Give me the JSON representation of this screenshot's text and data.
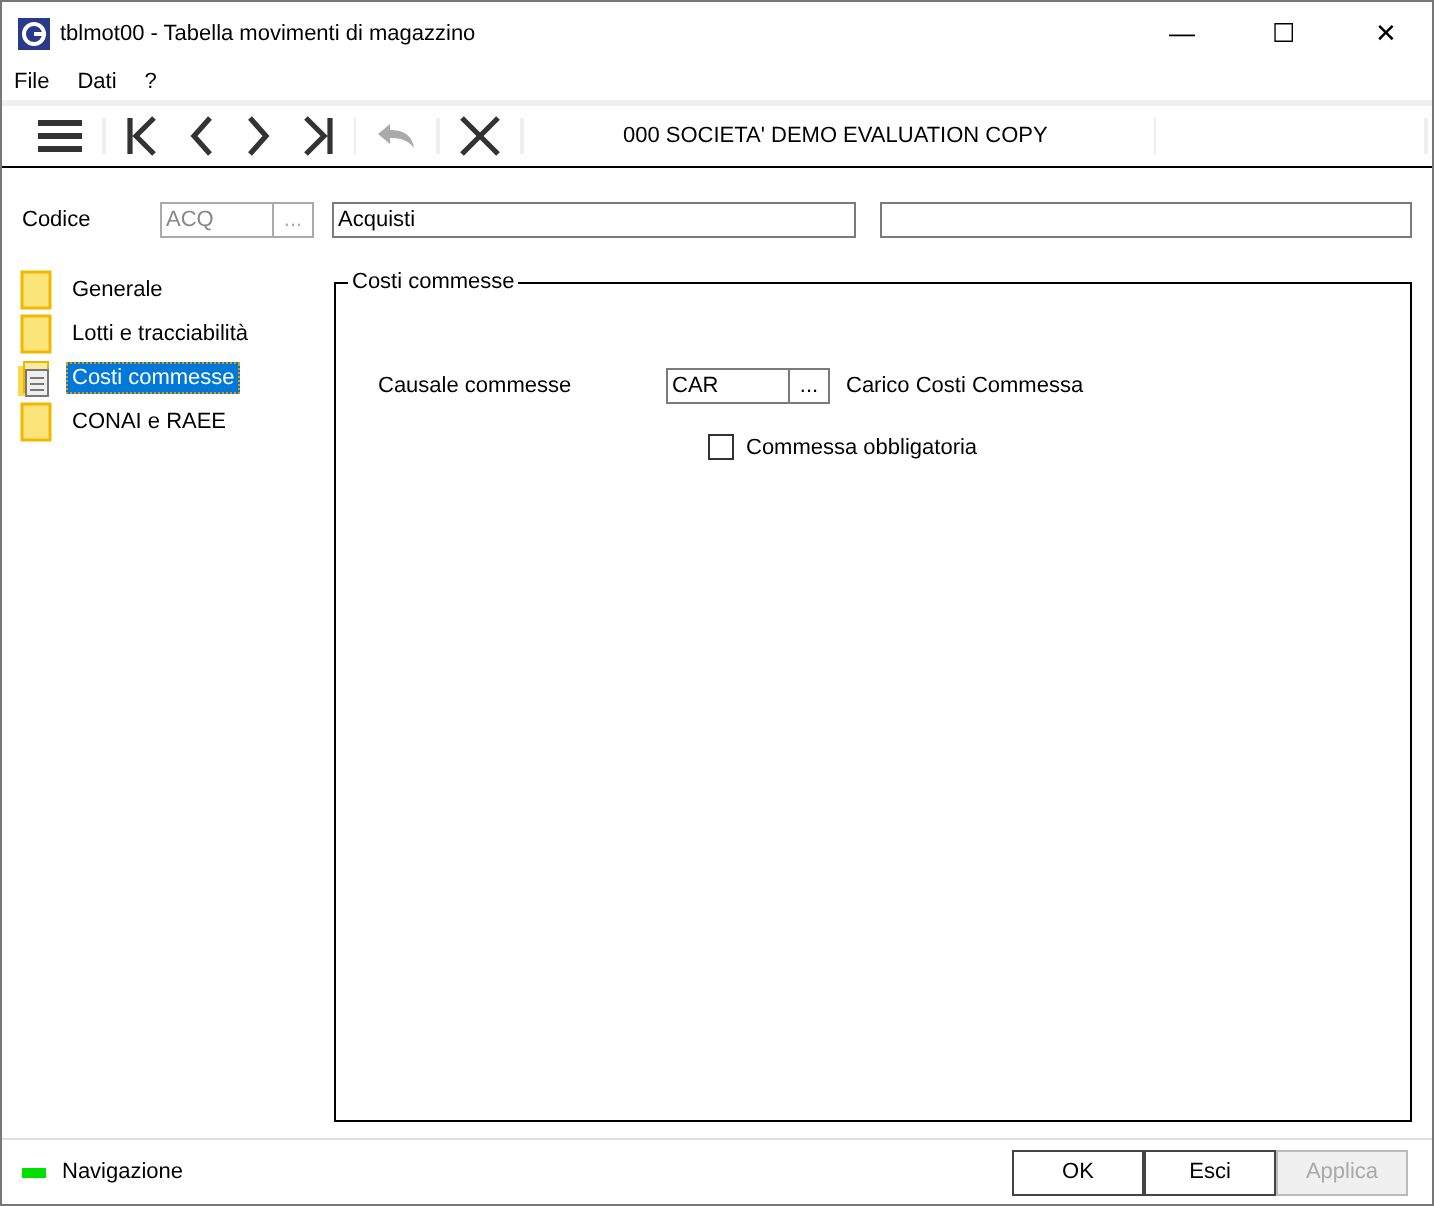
{
  "window": {
    "title": "tblmot00 - Tabella movimenti di magazzino",
    "controls": [
      "—",
      "☐",
      "✕"
    ]
  },
  "menu": [
    {
      "label": "File"
    },
    {
      "label": "Dati"
    },
    {
      "label": "?"
    }
  ],
  "toolbar": {
    "buttons": [
      {
        "kind": "menu",
        "disabled": false
      },
      {
        "kind": "first",
        "disabled": false
      },
      {
        "kind": "prev",
        "disabled": false
      },
      {
        "kind": "next",
        "disabled": false
      },
      {
        "kind": "last",
        "disabled": false
      },
      {
        "kind": "undo",
        "disabled": true
      },
      {
        "kind": "close",
        "disabled": false
      }
    ],
    "company": "000 SOCIETA' DEMO EVALUATION COPY"
  },
  "header": {
    "label": "Codice",
    "code": {
      "value": "ACQ",
      "disabled": true
    },
    "lookup": {
      "label": "...",
      "disabled": true
    },
    "description": "Acquisti"
  },
  "tree": [
    {
      "label": "Generale",
      "selected": false
    },
    {
      "label": "Lotti e tracciabilità",
      "selected": false
    },
    {
      "label": "Costi commesse",
      "selected": true
    },
    {
      "label": "CONAI e RAEE",
      "selected": false
    }
  ],
  "panel": {
    "title": "Costi commesse",
    "causale": {
      "label": "Causale commesse",
      "value": "CAR",
      "lookup": "...",
      "description": "Carico Costi Commessa"
    },
    "checkbox": {
      "label": "Commessa obbligatoria",
      "checked": false
    }
  },
  "status_bar": {
    "mode": "Navigazione",
    "color": "#00e000",
    "buttons": [
      {
        "label": "OK",
        "disabled": false
      },
      {
        "label": "Esci",
        "disabled": false
      },
      {
        "label": "Applica",
        "disabled": true
      }
    ]
  }
}
